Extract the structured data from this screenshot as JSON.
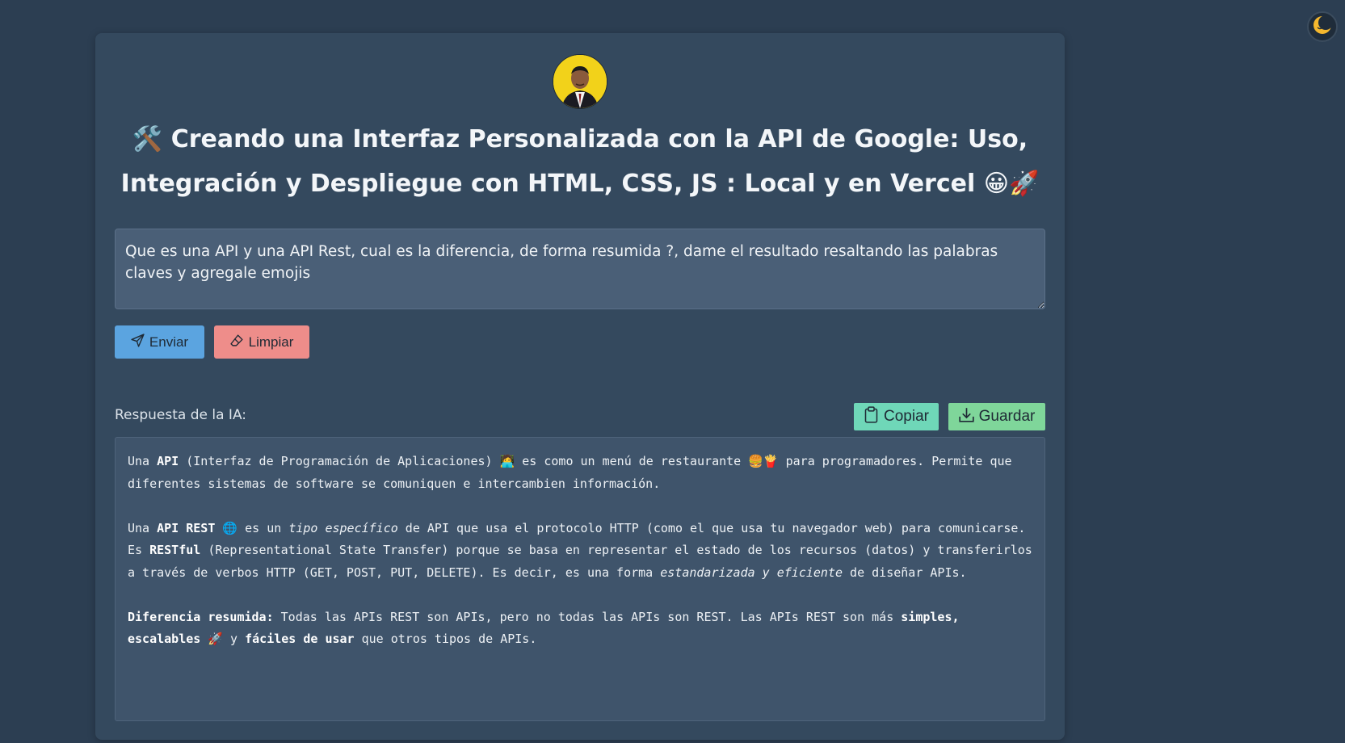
{
  "header": {
    "title": "🛠️ Creando una Interfaz Personalizada con la API de Google: Uso, Integración y Despliegue con HTML, CSS, JS : Local y en Vercel 😀🚀"
  },
  "prompt": {
    "value": "Que es una API y una API Rest, cual es la diferencia, de forma resumida ?, dame el resultado resaltando las palabras claves y agregale emojis"
  },
  "buttons": {
    "send_label": "Enviar",
    "clear_label": "Limpiar",
    "copy_label": "Copiar",
    "save_label": "Guardar"
  },
  "response": {
    "label": "Respuesta de la IA:",
    "p1": {
      "t1": "Una ",
      "b1": "API",
      "t2": " (Interfaz de Programación de Aplicaciones) 🧑‍💻 es como un menú de restaurante 🍔🍟 para programadores.  Permite que diferentes sistemas de software se comuniquen e intercambien información."
    },
    "p2": {
      "t1": "Una ",
      "b1": "API REST",
      "t2": " 🌐 es un ",
      "i1": "tipo específico",
      "t3": " de API que usa el protocolo HTTP (como el que usa tu navegador web) para comunicarse.  Es ",
      "b2": "RESTful",
      "t4": " (Representational State Transfer) porque se basa en representar el estado de los recursos (datos) y transferirlos a través de verbos HTTP (GET, POST, PUT, DELETE).  Es decir, es una forma ",
      "i2": "estandarizada y eficiente",
      "t5": " de diseñar APIs."
    },
    "p3": {
      "b1": "Diferencia resumida:",
      "t1": " Todas las APIs REST son APIs, pero no todas las APIs son REST.  Las APIs REST son más ",
      "b2": "simples, escalables",
      "t2": " 🚀 y ",
      "b3": "fáciles de usar",
      "t3": " que otros tipos de APIs."
    }
  },
  "icons": {
    "theme": "moon-icon",
    "send": "send-icon",
    "clear": "eraser-icon",
    "copy": "clipboard-icon",
    "save": "download-icon"
  },
  "colors": {
    "background": "#2c3e52",
    "card": "#34495e",
    "send": "#5ba4e0",
    "clear": "#ee8d8a",
    "copy": "#6fd7b8",
    "save": "#7fd69a"
  }
}
